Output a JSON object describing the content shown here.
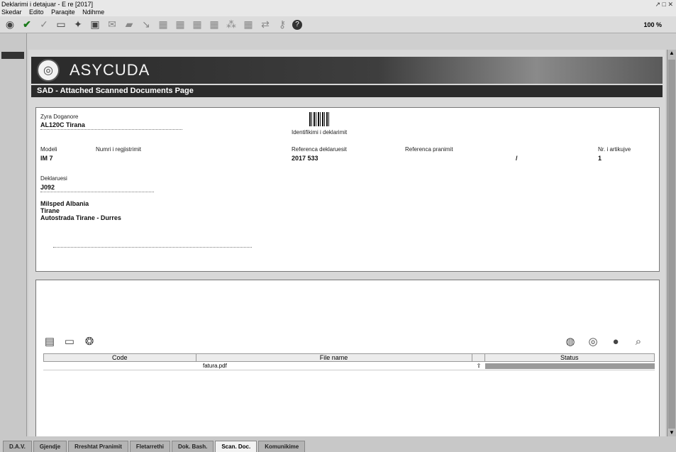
{
  "window": {
    "title": "Deklarimi i detajuar - E re [2017]",
    "controls": "↗ □ ✕"
  },
  "menu": [
    "Skedar",
    "Edito",
    "Paraqite",
    "Ndihme"
  ],
  "toolbar": {
    "zoom": "100 %"
  },
  "banner": {
    "brand": "ASYCUDA"
  },
  "page_title": "SAD - Attached Scanned Documents Page",
  "header": {
    "office_label": "Zyra Doganore",
    "office_value": "AL120C  Tirana",
    "declaration_id_label": "Identifikimi i deklarimit",
    "model_label": "Modeli",
    "model_value": "IM     7",
    "registration_label": "Numri i regjistrimit",
    "declarant_ref_label": "Referenca deklaruesit",
    "declarant_ref_value": "2017   533",
    "payment_ref_label": "Referenca pranimit",
    "payment_ref_sep": "/",
    "items_label": "Nr. i artikujve",
    "items_value": "1",
    "declarant_label": "Deklaruesi",
    "declarant_code": "J092",
    "declarant_name": "Milsped Albania",
    "declarant_city": "Tirane",
    "declarant_address": "Autostrada Tirane - Durres"
  },
  "table": {
    "headers": {
      "code": "Code",
      "file": "File name",
      "status": "Status"
    },
    "rows": [
      {
        "code": "",
        "file": "fatura.pdf",
        "status": ""
      }
    ]
  },
  "tabs": [
    "D.A.V.",
    "Gjendje",
    "Rreshtat Pranimit",
    "Fletarrethi",
    "Dok. Bash.",
    "Scan. Doc.",
    "Komunikime"
  ],
  "active_tab": "Scan. Doc."
}
